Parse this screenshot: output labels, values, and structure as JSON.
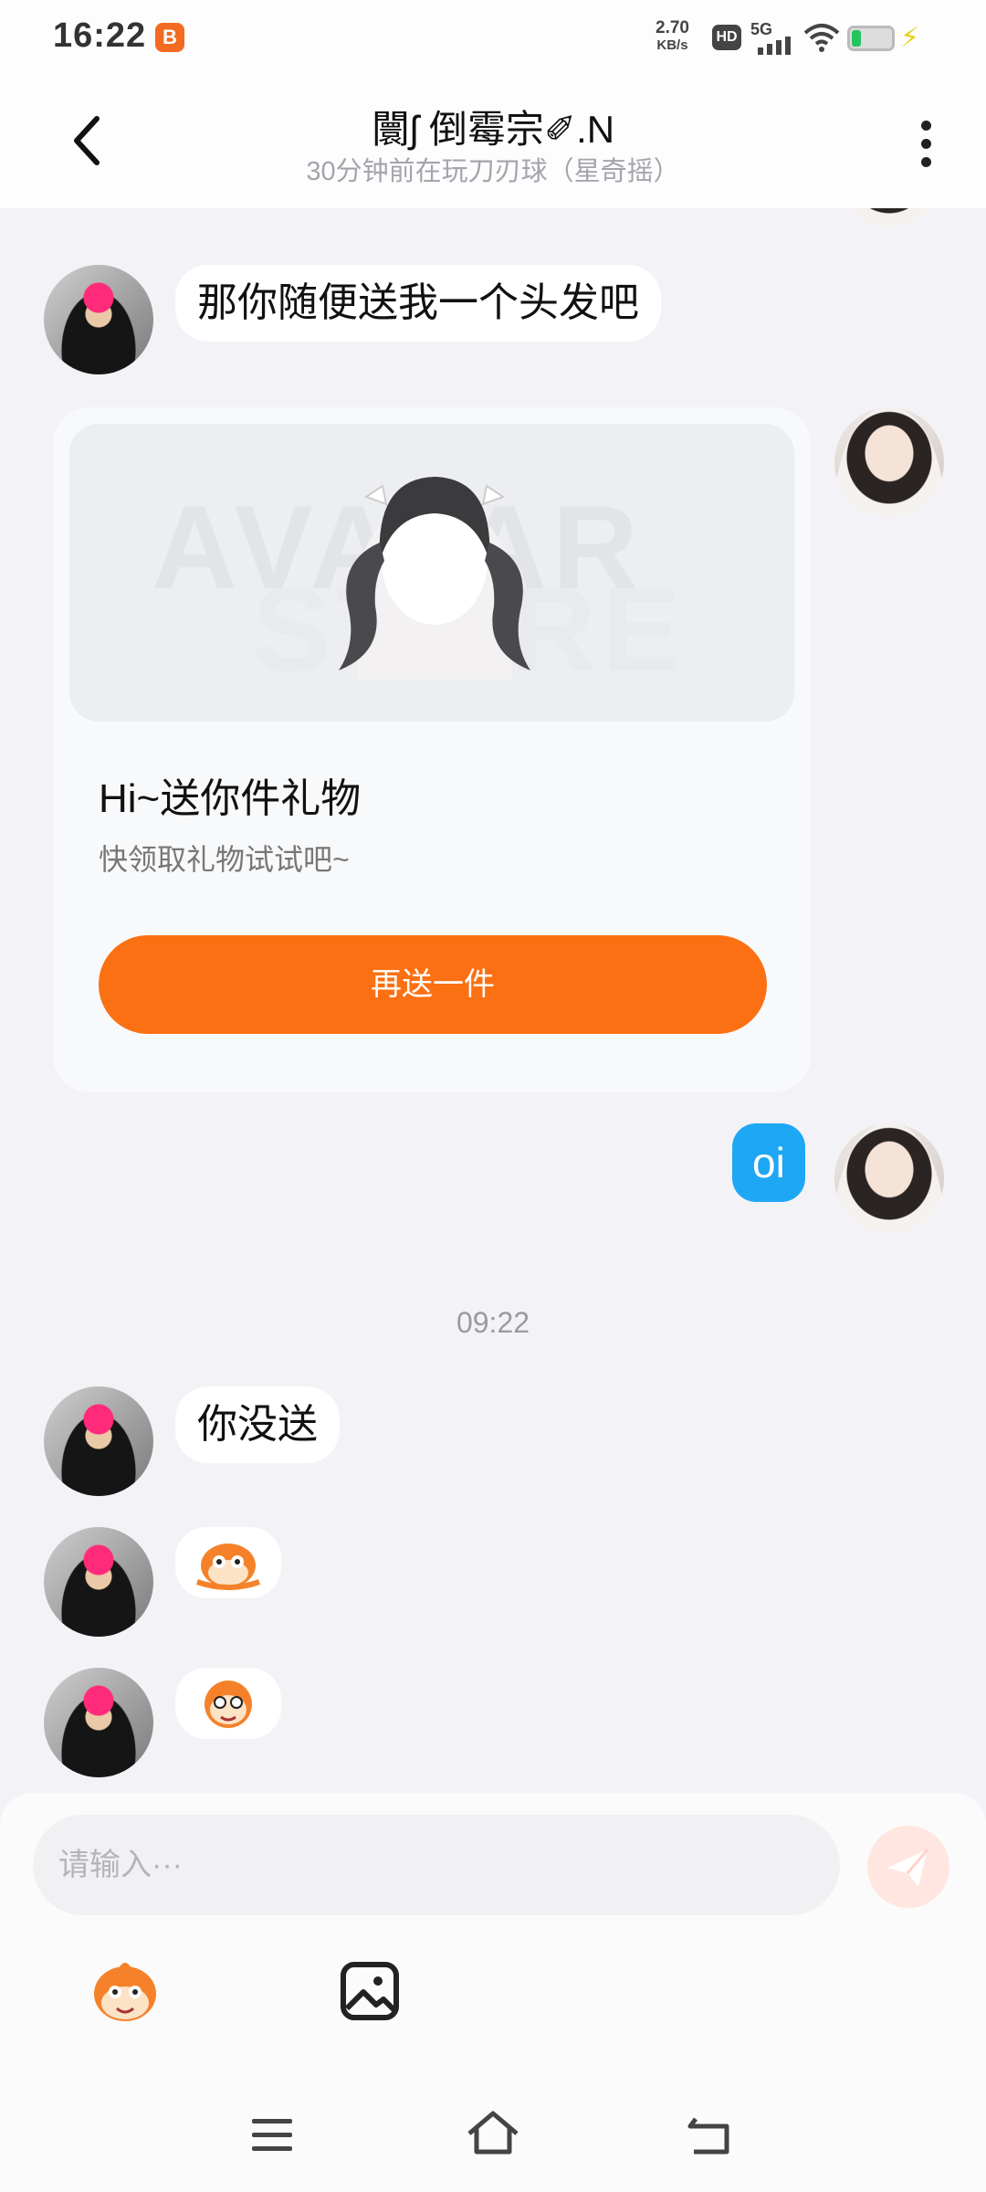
{
  "status_bar": {
    "time": "16:22",
    "app_badge": "B",
    "speed_value": "2.70",
    "speed_unit": "KB/s",
    "hd": "HD",
    "network": "5G"
  },
  "header": {
    "title": "闤ʃ 倒霉宗✐.N",
    "subtitle": "30分钟前在玩刀刃球（星奇摇）"
  },
  "messages": {
    "msg1": "那你随便送我一个头发吧",
    "gift": {
      "watermark_line1": "AVATAR",
      "watermark_line2": "STORE",
      "title": "Hi~送你件礼物",
      "subtitle": "快领取礼物试试吧~",
      "button": "再送一件"
    },
    "msg_oi": "oi",
    "timestamp": "09:22",
    "msg_not_sent": "你没送"
  },
  "composer": {
    "placeholder": "请输入···"
  },
  "colors": {
    "accent_orange": "#fb7012",
    "bubble_blue": "#1ea7f4",
    "background": "#f3f3f7"
  },
  "icons": {
    "back": "chevron-left-icon",
    "more": "more-vertical-icon",
    "send": "paper-plane-icon",
    "emoji": "monkey-emoji-icon",
    "image": "image-icon",
    "nav_menu": "menu-icon",
    "nav_home": "home-icon",
    "nav_back": "back-icon"
  }
}
